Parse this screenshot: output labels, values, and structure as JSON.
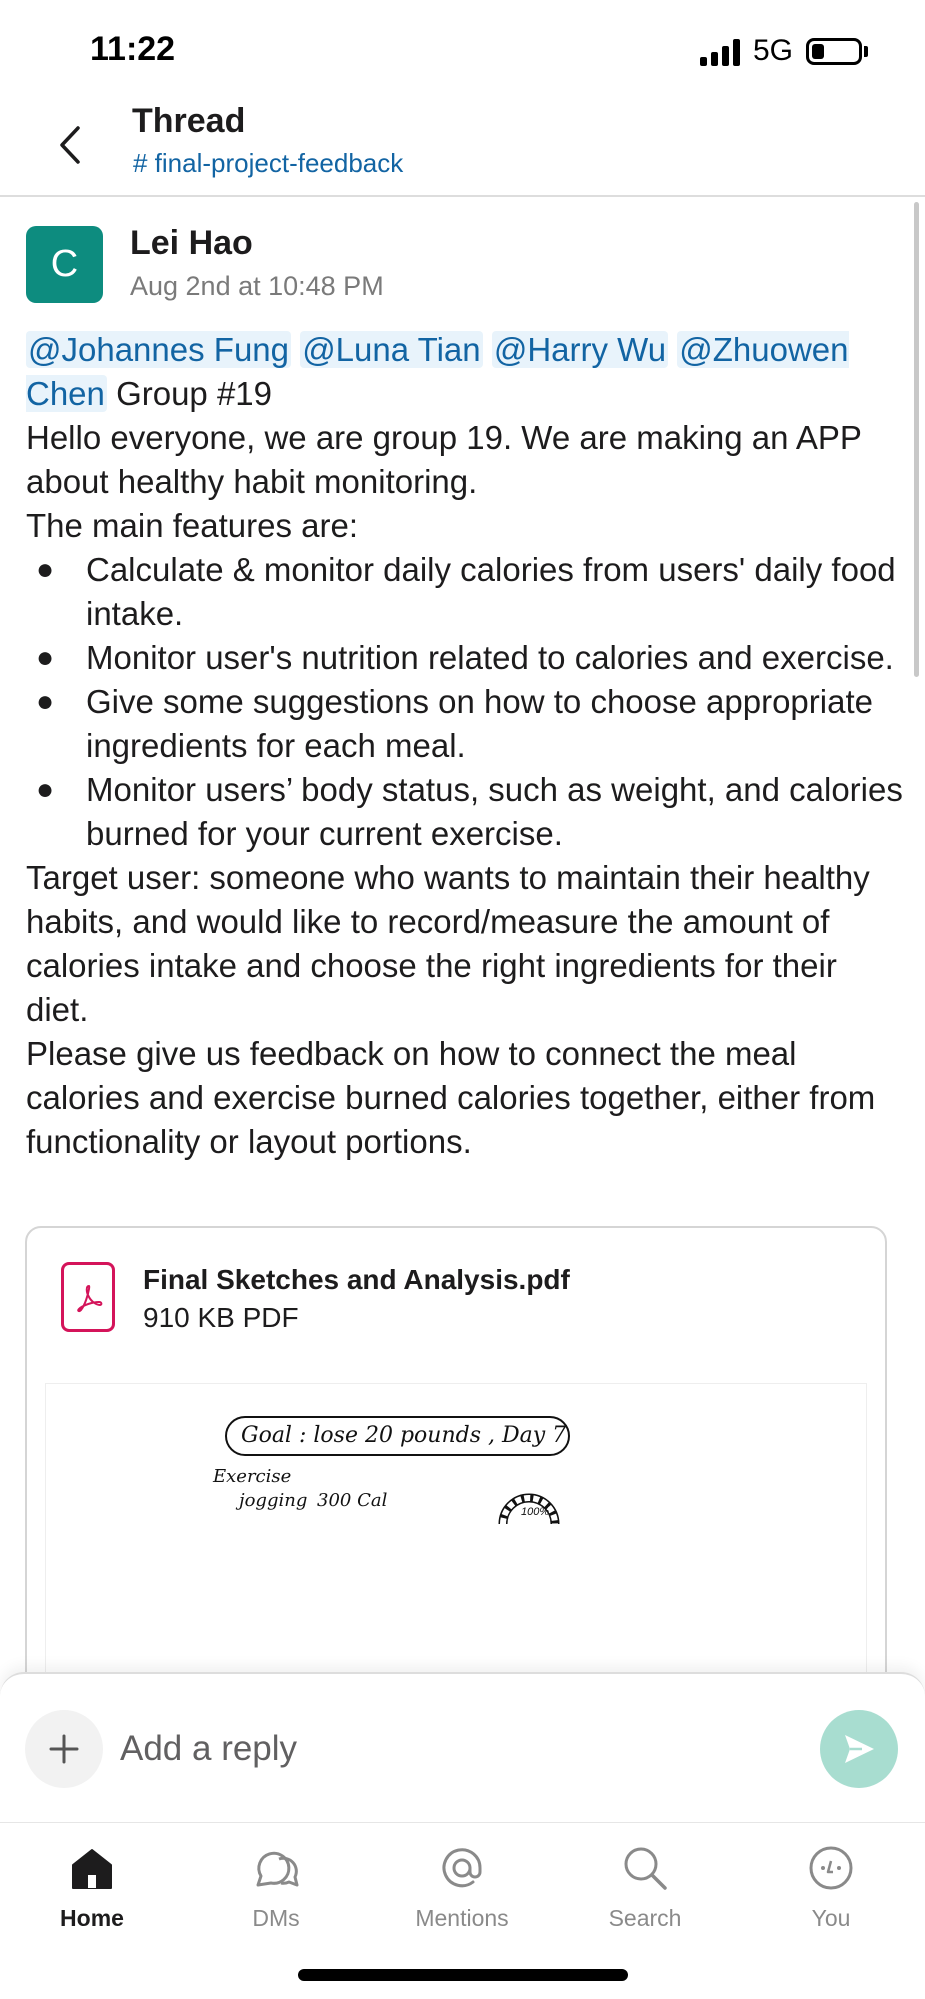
{
  "status_bar": {
    "time": "11:22",
    "network": "5G",
    "signal_bars": 4,
    "battery_level": 0.2
  },
  "header": {
    "title": "Thread",
    "channel": "# final-project-feedback",
    "back_icon": "chevron-left-icon"
  },
  "message": {
    "avatar_letter": "C",
    "avatar_color": "#0d8c7f",
    "author": "Lei Hao",
    "timestamp": "Aug 2nd at 10:48 PM",
    "mentions": [
      "@Johannes Fung",
      "@Luna Tian",
      "@Harry Wu",
      "@Zhuowen Chen"
    ],
    "group": "Group #19",
    "intro": "Hello everyone, we are group 19. We are making an APP about healthy habit monitoring.",
    "features_heading": "The main features are:",
    "bullet": "●",
    "features": [
      "Calculate & monitor daily calories from users' daily food intake.",
      "Monitor user's nutrition related to calories and exercise.",
      "Give some suggestions on how to choose appropriate ingredients for each meal.",
      "Monitor users’ body status, such as weight, and calories burned for your current exercise."
    ],
    "target_user": "Target user: someone who wants to maintain their healthy habits, and would like to record/measure the amount of calories intake and choose the right ingredients for their diet.",
    "request": "Please give us feedback on how to connect the meal calories and exercise burned calories together, either from functionality or layout portions."
  },
  "attachment": {
    "file_name": "Final Sketches and Analysis.pdf",
    "file_meta": "910 KB PDF",
    "icon": "pdf-file-icon",
    "preview": {
      "goal": "Goal : lose 20 pounds , Day 7",
      "exercise_label": "Exercise",
      "activity": "jogging",
      "calories": "300 Cal",
      "gauge_percent": "100%"
    }
  },
  "composer": {
    "placeholder": "Add a reply",
    "add_icon": "plus-icon",
    "send_icon": "send-icon",
    "send_color": "#a8ddd0"
  },
  "tabs": [
    {
      "label": "Home",
      "icon": "home-icon",
      "active": true
    },
    {
      "label": "DMs",
      "icon": "dms-icon",
      "active": false
    },
    {
      "label": "Mentions",
      "icon": "mentions-icon",
      "active": false
    },
    {
      "label": "Search",
      "icon": "search-icon",
      "active": false
    },
    {
      "label": "You",
      "icon": "you-icon",
      "active": false
    }
  ]
}
